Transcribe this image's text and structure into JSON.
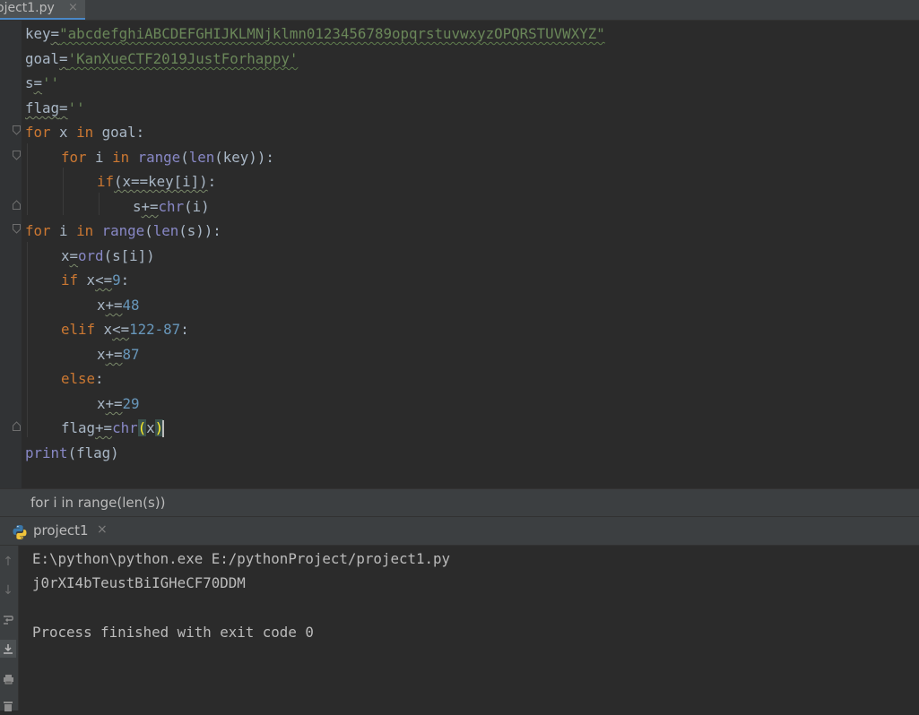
{
  "editor_tab": {
    "filename": "oject1.py",
    "close": "×"
  },
  "code": {
    "l1": {
      "a": "key",
      "b": "=",
      "c": "\"abcdefghiABCDEFGHIJKLMNjklmn0123456789opqrstuvwxyzOPQRSTUVWXYZ\""
    },
    "l2": {
      "a": "goal",
      "b": "=",
      "c": "'KanXueCTF2019JustForhappy'"
    },
    "l3": {
      "a": "s",
      "b": "=",
      "c": "''"
    },
    "l4": {
      "a": "flag",
      "b": "=",
      "c": "''"
    },
    "l5": {
      "kw1": "for",
      "v": " x ",
      "kw2": "in",
      "rest": " goal:"
    },
    "l6": {
      "kw1": "for",
      "v": " i ",
      "kw2": "in",
      "f1": "range",
      "p1": "(",
      "f2": "len",
      "rest": "(key)):"
    },
    "l7": {
      "kw": "if",
      "cond": "(x==key[i])",
      "colon": ":"
    },
    "l8": {
      "a": "s",
      "b": "+=",
      "f": "chr",
      "c": "(i)"
    },
    "l9": {
      "kw1": "for",
      "v": " i ",
      "kw2": "in",
      "f1": "range",
      "p1": "(",
      "f2": "len",
      "rest": "(s)):"
    },
    "l10": {
      "a": "x",
      "b": "=",
      "f": "ord",
      "c": "(s[i])"
    },
    "l11": {
      "kw": "if",
      "v": " x",
      "op": "<=",
      "n": "9",
      "colon": ":"
    },
    "l12": {
      "a": "x",
      "op": "+=",
      "n": "48"
    },
    "l13": {
      "kw": "elif",
      "v": " x",
      "op": "<=",
      "n": "122-87",
      "colon": ":"
    },
    "l14": {
      "a": "x",
      "op": "+=",
      "n": "87"
    },
    "l15": {
      "kw": "else",
      "colon": ":"
    },
    "l16": {
      "a": "x",
      "op": "+=",
      "n": "29"
    },
    "l17": {
      "a": "flag",
      "op": "+=",
      "f": "chr",
      "po": "(",
      "x": "x",
      "pc": ")"
    },
    "l18": {
      "f": "print",
      "c": "(flag)"
    }
  },
  "breadcrumb": {
    "text": "for i in range(len(s))"
  },
  "run_panel": {
    "tab_label": "project1",
    "close": "×",
    "python_icon": "python-icon"
  },
  "console": {
    "cmd": "E:\\python\\python.exe E:/pythonProject/project1.py",
    "output": "j0rXI4bTeustBiIGHeCF70DDM",
    "exit": "Process finished with exit code 0"
  },
  "toolbar_icons": [
    "up-arrow-icon",
    "down-arrow-icon",
    "soft-wrap-icon",
    "scroll-to-end-icon",
    "print-icon",
    "trash-icon"
  ],
  "colors": {
    "background": "#2b2b2b",
    "keyword": "#cc7832",
    "string": "#6a8759",
    "number": "#6897bb",
    "builtin": "#8888c6",
    "text": "#a9b7c6"
  }
}
